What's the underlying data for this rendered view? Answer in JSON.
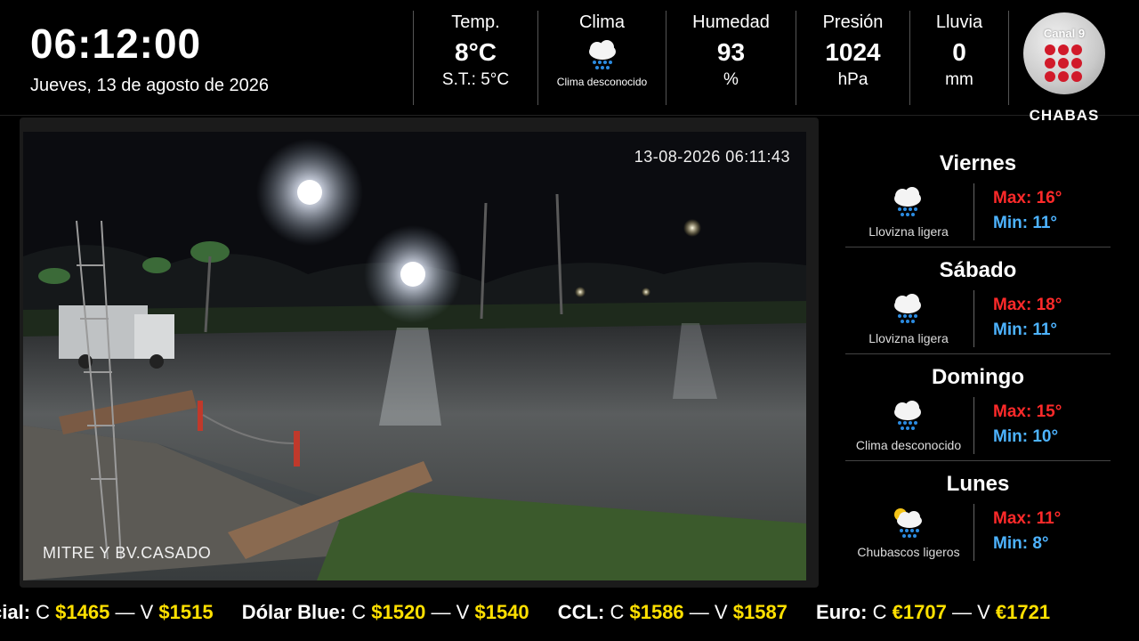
{
  "clock": "06:12:00",
  "date": "Jueves, 13 de agosto de 2026",
  "stats": {
    "temp": {
      "label": "Temp.",
      "value": "8°C",
      "feels": "S.T.: 5°C"
    },
    "clima": {
      "label": "Clima",
      "icon": "cloud-rain-icon",
      "desc": "Clima desconocido"
    },
    "humidity": {
      "label": "Humedad",
      "value": "93",
      "unit": "%"
    },
    "pressure": {
      "label": "Presión",
      "value": "1024",
      "unit": "hPa"
    },
    "rain": {
      "label": "Lluvia",
      "value": "0",
      "unit": "mm"
    }
  },
  "logo": {
    "channel": "Canal 9",
    "city": "CHABAS",
    "accent": "#d11a2a"
  },
  "camera": {
    "timestamp": "13-08-2026 06:11:43",
    "location": "MITRE Y BV.CASADO"
  },
  "forecast": [
    {
      "day": "Viernes",
      "icon": "cloud-rain-icon",
      "desc": "Llovizna ligera",
      "max": "Max: 16°",
      "min": "Min: 11°"
    },
    {
      "day": "Sábado",
      "icon": "cloud-rain-icon",
      "desc": "Llovizna ligera",
      "max": "Max: 18°",
      "min": "Min: 11°"
    },
    {
      "day": "Domingo",
      "icon": "cloud-rain-icon",
      "desc": "Clima desconocido",
      "max": "Max: 15°",
      "min": "Min: 10°"
    },
    {
      "day": "Lunes",
      "icon": "sun-cloud-rain-icon",
      "desc": "Chubascos ligeros",
      "max": "Max: 11°",
      "min": "Min: 8°"
    }
  ],
  "ticker": [
    {
      "name": "cial:",
      "c": "C",
      "buy": "$1465",
      "sep": "—",
      "v": "V",
      "sell": "$1515"
    },
    {
      "name": "Dólar Blue:",
      "c": "C",
      "buy": "$1520",
      "sep": "—",
      "v": "V",
      "sell": "$1540"
    },
    {
      "name": "CCL:",
      "c": "C",
      "buy": "$1586",
      "sep": "—",
      "v": "V",
      "sell": "$1587"
    },
    {
      "name": "Euro:",
      "c": "C",
      "buy": "€1707",
      "sep": "—",
      "v": "V",
      "sell": "€1721"
    }
  ],
  "colors": {
    "max": "#ff2a2a",
    "min": "#4db3ff",
    "price": "#ffe000"
  }
}
